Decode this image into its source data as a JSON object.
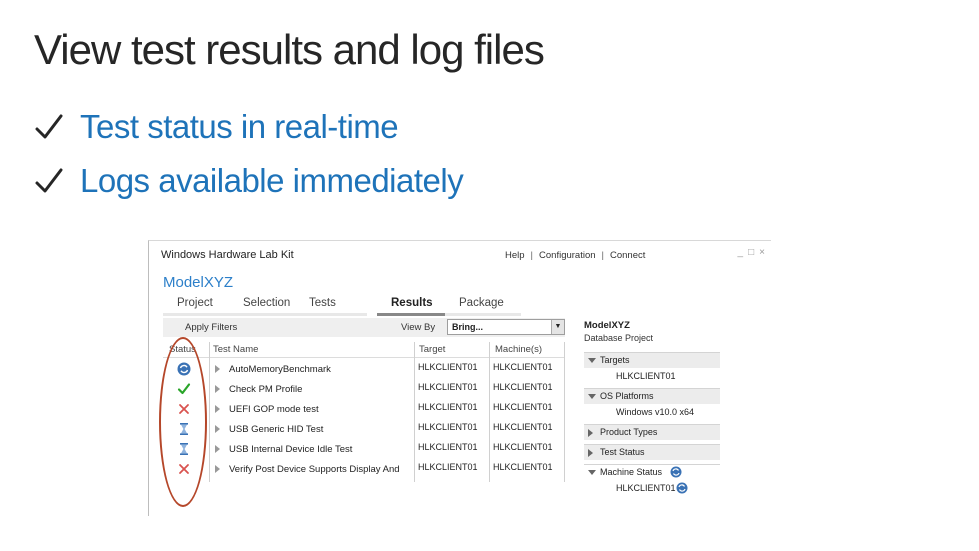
{
  "slide": {
    "title": "View test results and log files",
    "bullets": [
      "Test status in real-time",
      "Logs available immediately"
    ]
  },
  "colors": {
    "bullet_text": "#1e73b9",
    "accent": "#2c7fc9",
    "annotation_oval": "#b5472a",
    "pass": "#2aa52a",
    "fail": "#d9534f",
    "running": "#3a72b5"
  },
  "app": {
    "title": "Windows Hardware Lab Kit",
    "menu": [
      "Help",
      "Configuration",
      "Connect"
    ],
    "window_controls": [
      "_",
      "□",
      "×"
    ],
    "project_name": "ModelXYZ",
    "tabs": [
      "Project",
      "Selection",
      "Tests",
      "Results",
      "Package"
    ],
    "active_tab": "Results",
    "filter": {
      "apply_label": "Apply Filters",
      "view_by_label": "View By",
      "view_by_value": "Bring..."
    },
    "grid": {
      "columns": [
        "Status",
        "Test Name",
        "Target",
        "Machine(s)"
      ],
      "rows": [
        {
          "status": "running",
          "status_icon": "refresh-icon",
          "name": "AutoMemoryBenchmark",
          "target": "HLKCLIENT01",
          "machine": "HLKCLIENT01"
        },
        {
          "status": "passed",
          "status_icon": "check-icon",
          "name": "Check PM Profile",
          "target": "HLKCLIENT01",
          "machine": "HLKCLIENT01"
        },
        {
          "status": "failed",
          "status_icon": "x-icon",
          "name": "UEFI GOP mode test",
          "target": "HLKCLIENT01",
          "machine": "HLKCLIENT01"
        },
        {
          "status": "pending",
          "status_icon": "hourglass-icon",
          "name": "USB Generic HID Test",
          "target": "HLKCLIENT01",
          "machine": "HLKCLIENT01"
        },
        {
          "status": "pending",
          "status_icon": "hourglass-icon",
          "name": "USB Internal Device Idle Test",
          "target": "HLKCLIENT01",
          "machine": "HLKCLIENT01"
        },
        {
          "status": "failed",
          "status_icon": "x-icon",
          "name": "Verify Post Device Supports Display And",
          "target": "HLKCLIENT01",
          "machine": "HLKCLIENT01"
        }
      ]
    },
    "side_panel": {
      "title": "ModelXYZ",
      "subtitle": "Database Project",
      "targets_label": "Targets",
      "target_item": "HLKCLIENT01",
      "os_label": "OS Platforms",
      "os_item": "Windows v10.0 x64",
      "product_types_label": "Product Types",
      "test_status_label": "Test Status",
      "machine_status_label": "Machine Status",
      "machine_item": "HLKCLIENT01"
    }
  }
}
